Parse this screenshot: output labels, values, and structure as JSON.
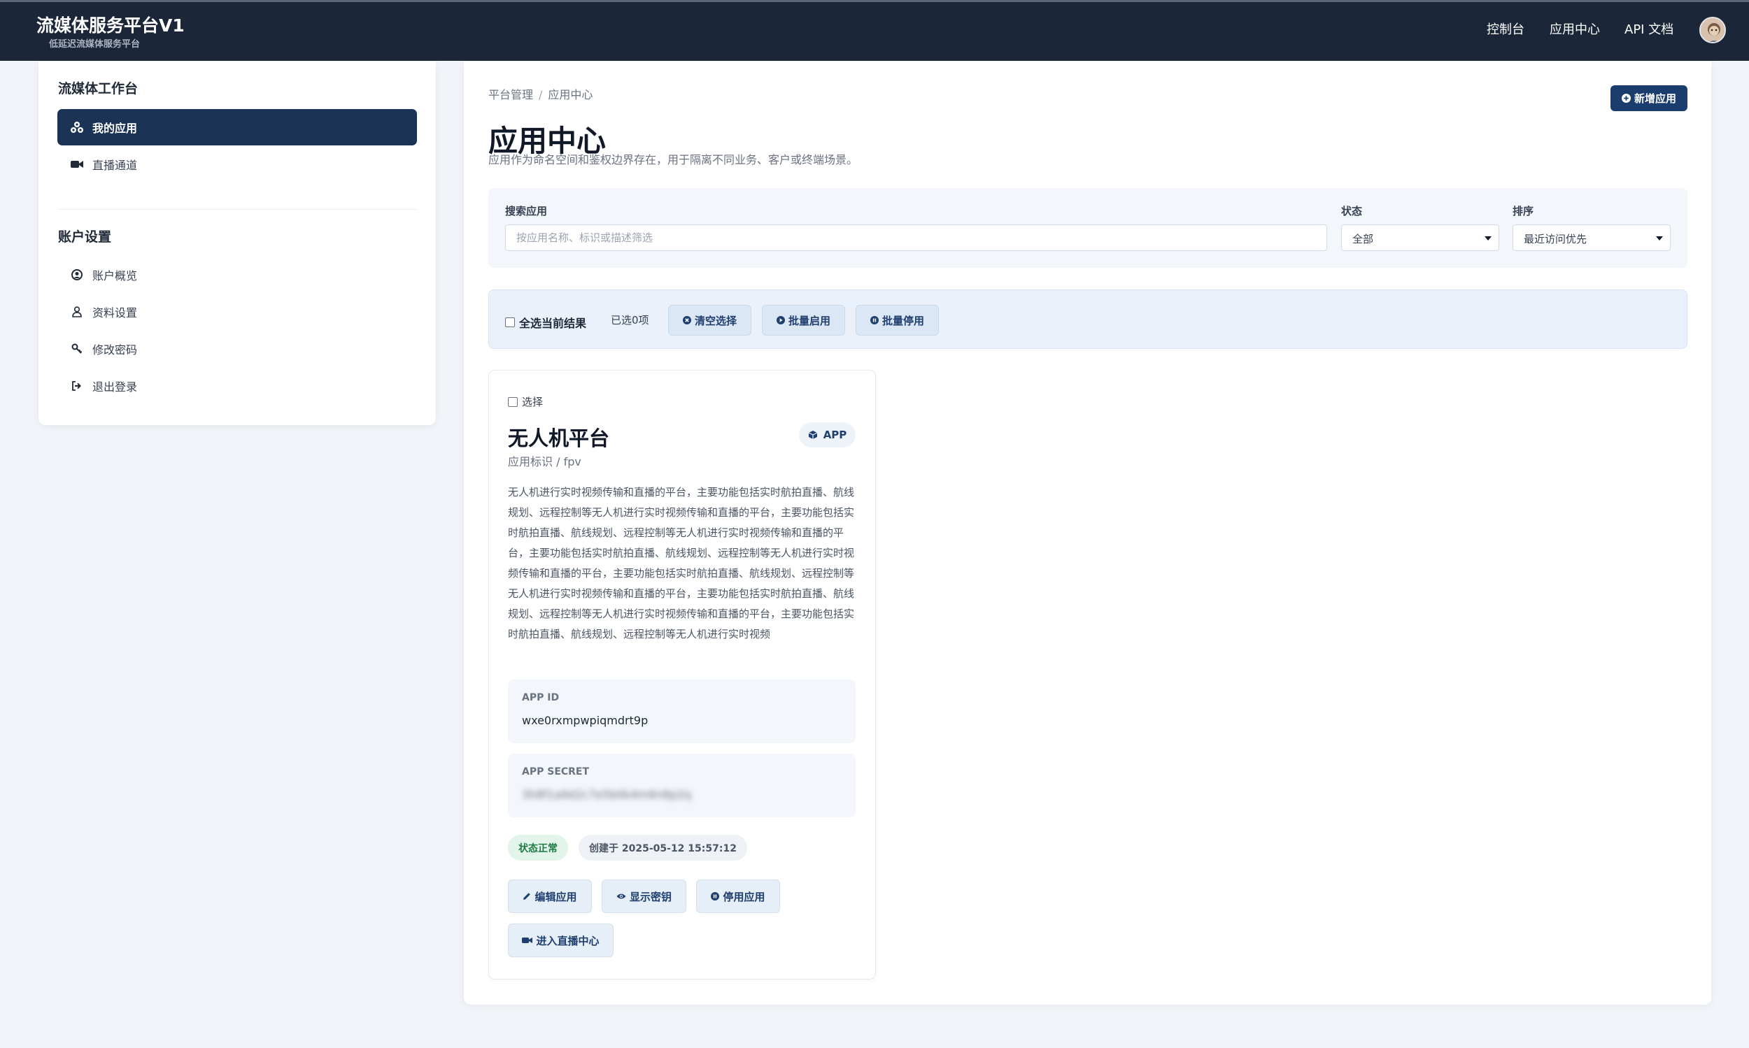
{
  "header": {
    "brand_title": "流媒体服务平台V1",
    "brand_subtitle": "低延迟流媒体服务平台",
    "nav": [
      "控制台",
      "应用中心",
      "API 文档"
    ]
  },
  "sidebar": {
    "workspace_heading": "流媒体工作台",
    "workspace_items": [
      {
        "label": "我的应用",
        "icon": "apps-icon",
        "active": true
      },
      {
        "label": "直播通道",
        "icon": "video-camera-icon",
        "active": false
      }
    ],
    "account_heading": "账户设置",
    "account_items": [
      {
        "label": "账户概览",
        "icon": "user-circle-icon"
      },
      {
        "label": "资料设置",
        "icon": "user-icon"
      },
      {
        "label": "修改密码",
        "icon": "key-icon"
      },
      {
        "label": "退出登录",
        "icon": "sign-out-icon"
      }
    ]
  },
  "main": {
    "breadcrumb": [
      "平台管理",
      "应用中心"
    ],
    "new_app_button": "新增应用",
    "title": "应用中心",
    "description": "应用作为命名空间和鉴权边界存在，用于隔离不同业务、客户或终端场景。",
    "filters": {
      "search_label": "搜索应用",
      "search_placeholder": "按应用名称、标识或描述筛选",
      "search_value": "",
      "status_label": "状态",
      "status_value": "全部",
      "sort_label": "排序",
      "sort_value": "最近访问优先"
    },
    "bulk": {
      "select_all": "全选当前结果",
      "selected_count": "已选0项",
      "clear": "清空选择",
      "enable": "批量启用",
      "disable": "批量停用"
    },
    "apps": [
      {
        "select_label": "选择",
        "name": "无人机平台",
        "type_badge": "APP",
        "identifier": "应用标识 / fpv",
        "description": "无人机进行实时视频传输和直播的平台，主要功能包括实时航拍直播、航线规划、远程控制等无人机进行实时视频传输和直播的平台，主要功能包括实时航拍直播、航线规划、远程控制等无人机进行实时视频传输和直播的平台，主要功能包括实时航拍直播、航线规划、远程控制等无人机进行实时视频传输和直播的平台，主要功能包括实时航拍直播、航线规划、远程控制等无人机进行实时视频传输和直播的平台，主要功能包括实时航拍直播、航线规划、远程控制等无人机进行实时视频传输和直播的平台，主要功能包括实时航拍直播、航线规划、远程控制等无人机进行实时视频",
        "app_id_label": "APP ID",
        "app_id": "wxe0rxmpwpiqmdrt9p",
        "app_secret_label": "APP SECRET",
        "app_secret": "3h8f1a9d2c7e5b0k4m6n8p2q",
        "status": "状态正常",
        "created": "创建于 2025-05-12 15:57:12",
        "actions": [
          "编辑应用",
          "显示密钥",
          "停用应用",
          "进入直播中心"
        ]
      }
    ]
  },
  "colors": {
    "navbar": "#1b2638",
    "accent": "#1b3d6e",
    "sidebar_active": "#1b3355",
    "status_ok": "#1f7a44"
  }
}
